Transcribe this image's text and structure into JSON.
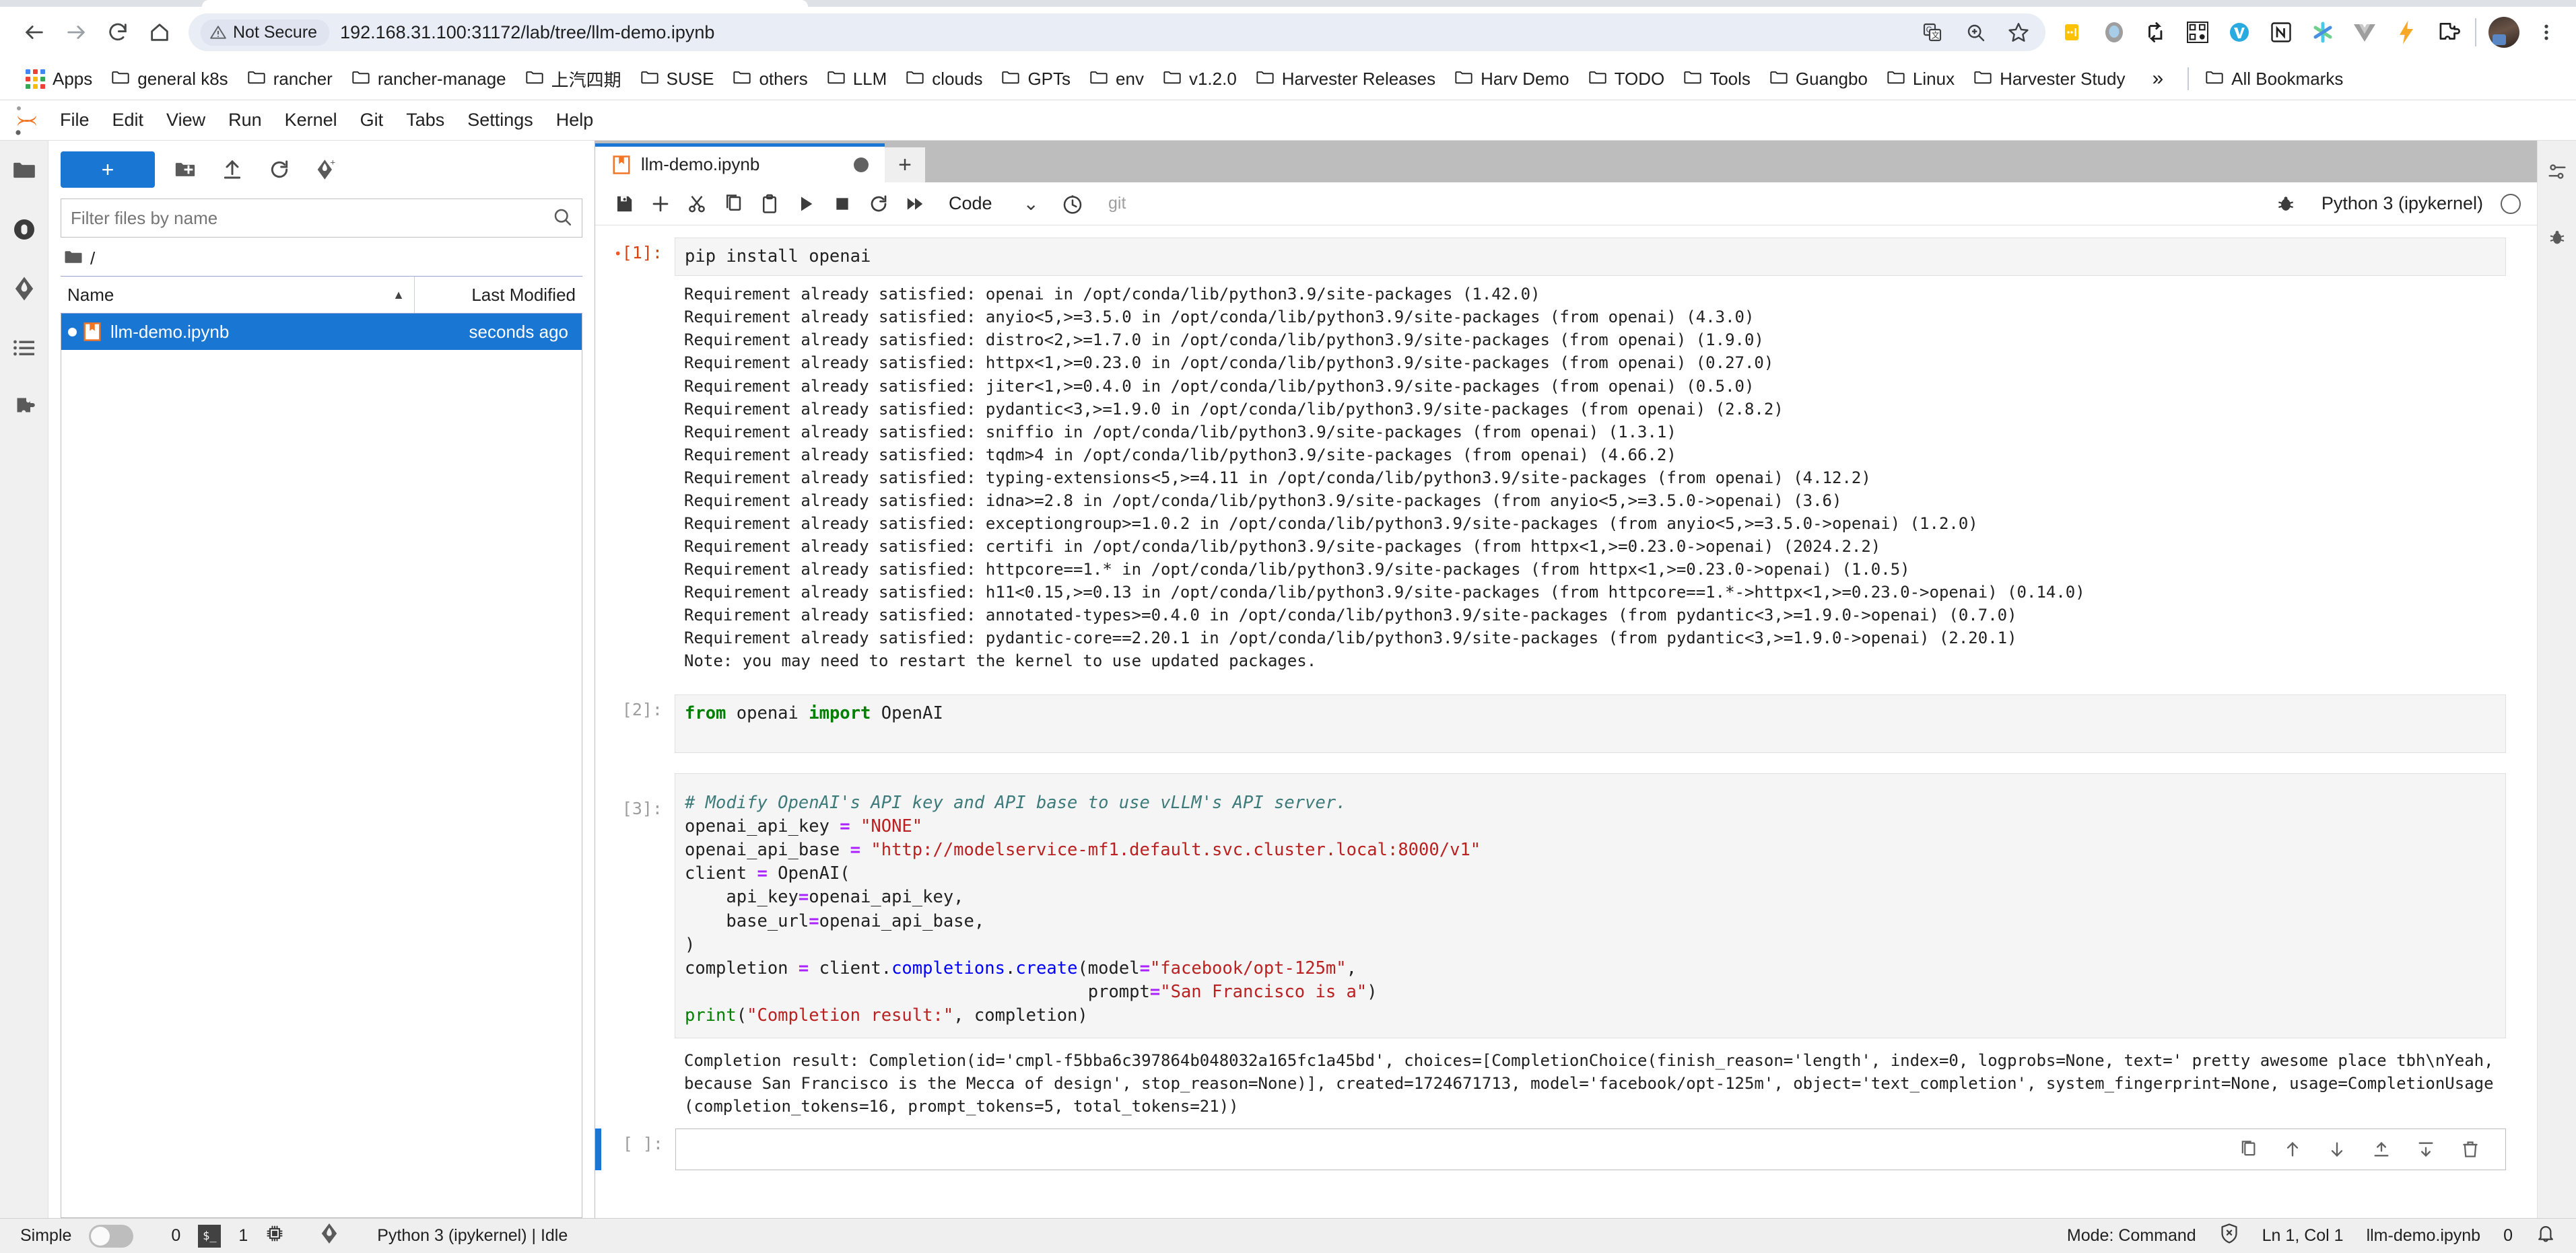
{
  "browser": {
    "nav": {
      "back_label": "Back",
      "forward_label": "Forward",
      "reload_label": "Reload",
      "home_label": "Home"
    },
    "omnibox": {
      "security_label": "Not Secure",
      "url": "192.168.31.100:31172/lab/tree/llm-demo.ipynb"
    },
    "omni_icons": [
      "translate-icon",
      "zoom-icon",
      "bookmark-star-icon"
    ],
    "extension_icons": [
      "extension-yellow-icon",
      "extension-gray-circle-icon",
      "extension-recycle-icon",
      "extension-qrcode-icon",
      "extension-v-blue-icon",
      "extension-notion-icon",
      "extension-asterisk-icon",
      "extension-vue-icon",
      "extension-lightning-icon",
      "extension-puzzle-icon"
    ],
    "bookmarks": [
      {
        "label": "Apps",
        "icon": "apps-grid-icon"
      },
      {
        "label": "general k8s",
        "icon": "folder-icon"
      },
      {
        "label": "rancher",
        "icon": "folder-icon"
      },
      {
        "label": "rancher-manage",
        "icon": "folder-icon"
      },
      {
        "label": "上汽四期",
        "icon": "folder-icon"
      },
      {
        "label": "SUSE",
        "icon": "folder-icon"
      },
      {
        "label": "others",
        "icon": "folder-icon"
      },
      {
        "label": "LLM",
        "icon": "folder-icon"
      },
      {
        "label": "clouds",
        "icon": "folder-icon"
      },
      {
        "label": "GPTs",
        "icon": "folder-icon"
      },
      {
        "label": "env",
        "icon": "folder-icon"
      },
      {
        "label": "v1.2.0",
        "icon": "folder-icon"
      },
      {
        "label": "Harvester Releases",
        "icon": "folder-icon"
      },
      {
        "label": "Harv Demo",
        "icon": "folder-icon"
      },
      {
        "label": "TODO",
        "icon": "folder-icon"
      },
      {
        "label": "Tools",
        "icon": "folder-icon"
      },
      {
        "label": "Guangbo",
        "icon": "folder-icon"
      },
      {
        "label": "Linux",
        "icon": "folder-icon"
      },
      {
        "label": "Harvester Study",
        "icon": "folder-icon"
      }
    ],
    "overflow_label": "»",
    "all_bookmarks_label": "All Bookmarks"
  },
  "jupyter": {
    "menu": [
      "File",
      "Edit",
      "View",
      "Run",
      "Kernel",
      "Git",
      "Tabs",
      "Settings",
      "Help"
    ],
    "filebrowser": {
      "new_button_label": "+",
      "toolbar_icons": [
        "new-folder-icon",
        "upload-icon",
        "refresh-icon",
        "git-clone-icon"
      ],
      "filter_placeholder": "Filter files by name",
      "breadcrumb": "/",
      "columns": {
        "name": "Name",
        "last_modified": "Last Modified"
      },
      "sort_indicator": "▲",
      "rows": [
        {
          "name": "llm-demo.ipynb",
          "modified": "seconds ago",
          "selected": true,
          "running": true
        }
      ]
    },
    "notebook": {
      "tab_title": "llm-demo.ipynb",
      "add_tab_label": "+",
      "toolbar_icons": [
        "save-icon",
        "insert-cell-icon",
        "cut-icon",
        "copy-icon",
        "paste-icon",
        "run-icon",
        "stop-icon",
        "restart-icon",
        "restart-run-all-icon"
      ],
      "cell_type": "Code",
      "cell_type_caret": "⌄",
      "history_icon": "clock-icon",
      "git_label": "git",
      "debugger_icon": "bug-icon",
      "kernel_name": "Python 3 (ipykernel)",
      "cells": [
        {
          "prompt": "[1]:",
          "busy_marker": true,
          "source": "pip install openai",
          "output": "Requirement already satisfied: openai in /opt/conda/lib/python3.9/site-packages (1.42.0)\nRequirement already satisfied: anyio<5,>=3.5.0 in /opt/conda/lib/python3.9/site-packages (from openai) (4.3.0)\nRequirement already satisfied: distro<2,>=1.7.0 in /opt/conda/lib/python3.9/site-packages (from openai) (1.9.0)\nRequirement already satisfied: httpx<1,>=0.23.0 in /opt/conda/lib/python3.9/site-packages (from openai) (0.27.0)\nRequirement already satisfied: jiter<1,>=0.4.0 in /opt/conda/lib/python3.9/site-packages (from openai) (0.5.0)\nRequirement already satisfied: pydantic<3,>=1.9.0 in /opt/conda/lib/python3.9/site-packages (from openai) (2.8.2)\nRequirement already satisfied: sniffio in /opt/conda/lib/python3.9/site-packages (from openai) (1.3.1)\nRequirement already satisfied: tqdm>4 in /opt/conda/lib/python3.9/site-packages (from openai) (4.66.2)\nRequirement already satisfied: typing-extensions<5,>=4.11 in /opt/conda/lib/python3.9/site-packages (from openai) (4.12.2)\nRequirement already satisfied: idna>=2.8 in /opt/conda/lib/python3.9/site-packages (from anyio<5,>=3.5.0->openai) (3.6)\nRequirement already satisfied: exceptiongroup>=1.0.2 in /opt/conda/lib/python3.9/site-packages (from anyio<5,>=3.5.0->openai) (1.2.0)\nRequirement already satisfied: certifi in /opt/conda/lib/python3.9/site-packages (from httpx<1,>=0.23.0->openai) (2024.2.2)\nRequirement already satisfied: httpcore==1.* in /opt/conda/lib/python3.9/site-packages (from httpx<1,>=0.23.0->openai) (1.0.5)\nRequirement already satisfied: h11<0.15,>=0.13 in /opt/conda/lib/python3.9/site-packages (from httpcore==1.*->httpx<1,>=0.23.0->openai) (0.14.0)\nRequirement already satisfied: annotated-types>=0.4.0 in /opt/conda/lib/python3.9/site-packages (from pydantic<3,>=1.9.0->openai) (0.7.0)\nRequirement already satisfied: pydantic-core==2.20.1 in /opt/conda/lib/python3.9/site-packages (from pydantic<3,>=1.9.0->openai) (2.20.1)\nNote: you may need to restart the kernel to use updated packages."
        },
        {
          "prompt": "[2]:",
          "source": "from openai import OpenAI"
        },
        {
          "prompt": "[3]:",
          "source": "# Modify OpenAI's API key and API base to use vLLM's API server.\nopenai_api_key = \"NONE\"\nopenai_api_base = \"http://modelservice-mf1.default.svc.cluster.local:8000/v1\"\nclient = OpenAI(\n    api_key=openai_api_key,\n    base_url=openai_api_base,\n)\ncompletion = client.completions.create(model=\"facebook/opt-125m\",\n                                       prompt=\"San Francisco is a\")\nprint(\"Completion result:\", completion)",
          "output": "Completion result: Completion(id='cmpl-f5bba6c397864b048032a165fc1a45bd', choices=[CompletionChoice(finish_reason='length', index=0, logprobs=None, text=' pretty awesome place tbh\\nYeah, because San Francisco is the Mecca of design', stop_reason=None)], created=1724671713, model='facebook/opt-125m', object='text_completion', system_fingerprint=None, usage=CompletionUsage(completion_tokens=16, prompt_tokens=5, total_tokens=21))"
        },
        {
          "prompt": "[ ]:",
          "active": true,
          "source": "",
          "cell_toolbar_icons": [
            "duplicate-icon",
            "move-up-icon",
            "move-down-icon",
            "insert-above-icon",
            "insert-below-icon",
            "delete-cell-icon"
          ]
        }
      ]
    },
    "statusbar": {
      "simple_label": "Simple",
      "toggle_on": false,
      "kernel_count": "0",
      "terminal_icon": "terminal-icon",
      "terminal_count": "1",
      "cpu_icon": "cpu-icon",
      "git_icon": "git-icon",
      "kernel_status": "Python 3 (ipykernel) | Idle",
      "mode": "Mode: Command",
      "shield_icon": "shield-x-icon",
      "cursor": "Ln 1, Col 1",
      "filename": "llm-demo.ipynb",
      "notification_count": "0",
      "bell_icon": "bell-icon"
    }
  },
  "colors": {
    "accent_blue": "#1976d2",
    "not_secure_gray": "#5f6368",
    "jupyter_orange": "#f37626",
    "string_red": "#ba2121",
    "keyword_green": "#008000",
    "comment_teal": "#3d7b7b",
    "operator_purple": "#aa22ff"
  }
}
